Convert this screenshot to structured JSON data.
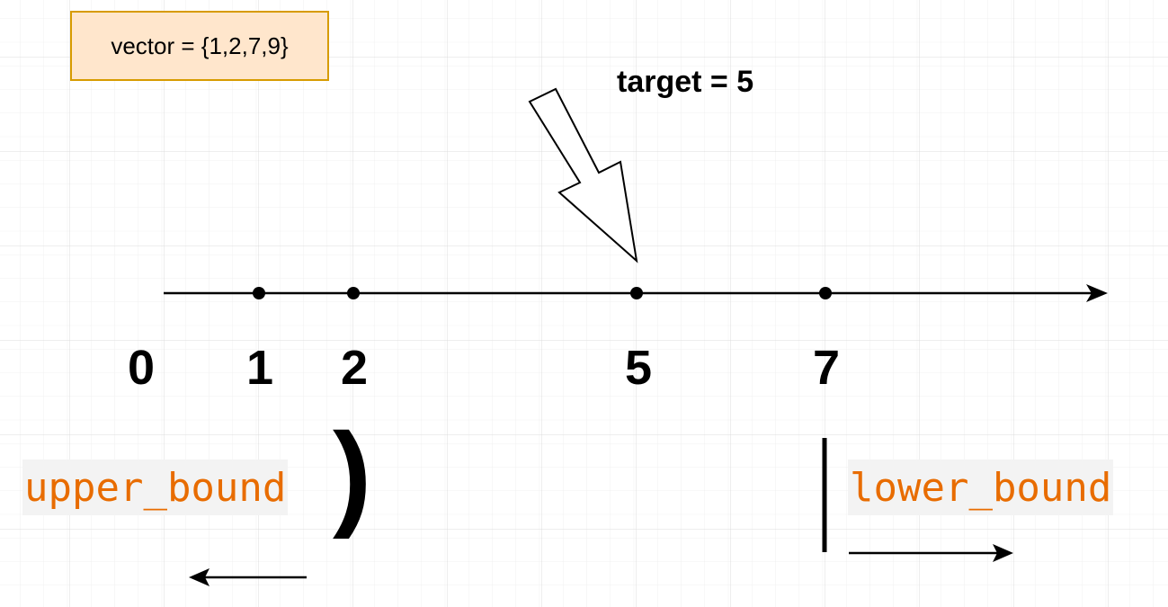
{
  "vector_box": {
    "label": "vector = {1,2,7,9}",
    "fill": "#ffe6cc",
    "stroke": "#d79b00"
  },
  "target_label": "target = 5",
  "number_line": {
    "ticks": [
      {
        "value": "0",
        "dot": false
      },
      {
        "value": "1",
        "dot": true
      },
      {
        "value": "2",
        "dot": true
      },
      {
        "value": "5",
        "dot": true
      },
      {
        "value": "7",
        "dot": true
      }
    ]
  },
  "upper_bound": {
    "label": "upper_bound",
    "bracket": ")",
    "direction": "left"
  },
  "lower_bound": {
    "label": "lower_bound",
    "bracket": "|",
    "direction": "right"
  },
  "colors": {
    "code_text": "#e86c00",
    "code_bg": "#f3f3f3",
    "grid": "#e0e0e0"
  }
}
